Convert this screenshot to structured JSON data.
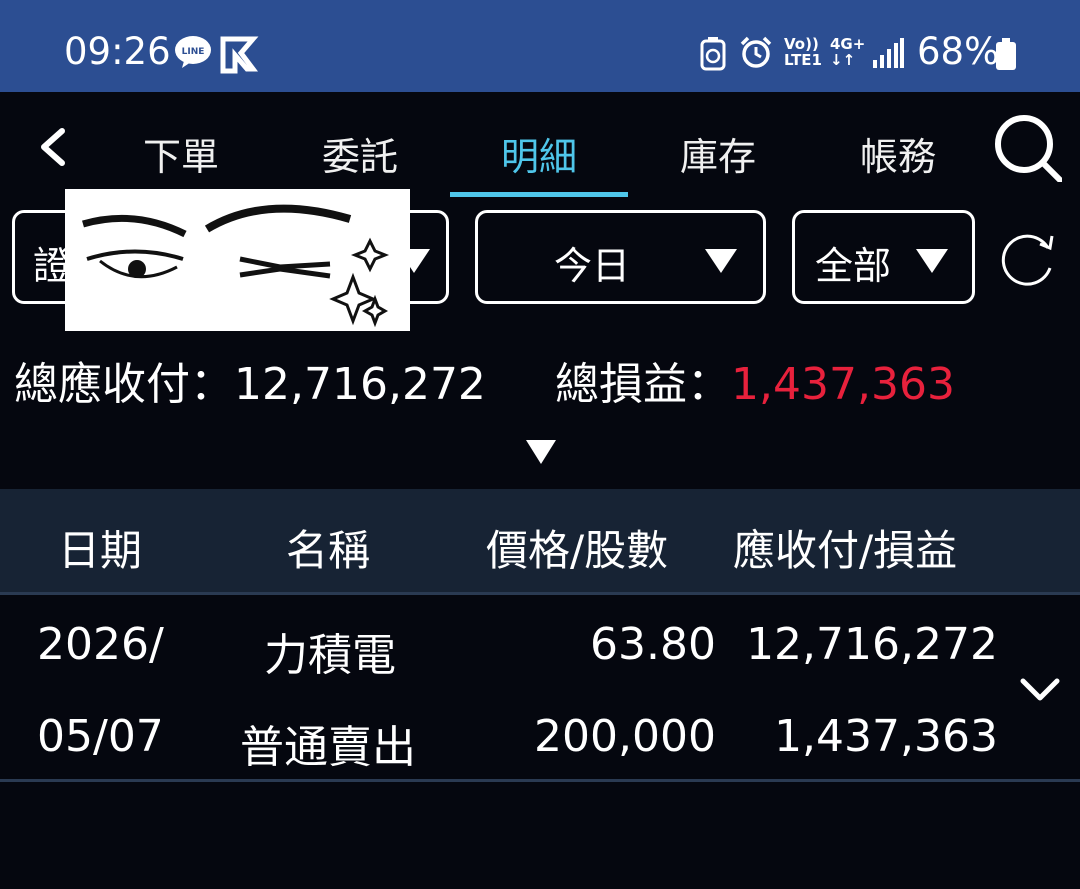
{
  "status_bar": {
    "time": "09:26",
    "line_icon_text": "LINE",
    "volte": "Vo))",
    "lte": "LTE1",
    "network": "4G+",
    "battery_pct": "68%",
    "icons": [
      "line-icon",
      "flag-icon",
      "recycle-icon",
      "alarm-icon",
      "signal-icon",
      "battery-icon"
    ]
  },
  "nav": {
    "tabs": [
      {
        "label": "下單",
        "active": false
      },
      {
        "label": "委託",
        "active": false
      },
      {
        "label": "明細",
        "active": true
      },
      {
        "label": "庫存",
        "active": false
      },
      {
        "label": "帳務",
        "active": false
      }
    ],
    "active_color": "#4fc6ea"
  },
  "filters": {
    "account_prefix": "證",
    "date_range": "今日",
    "category": "全部"
  },
  "totals": {
    "receivable_label": "總應收付：",
    "receivable_value": "12,716,272",
    "pnl_label": "總損益：",
    "pnl_value": "1,437,363"
  },
  "table": {
    "headers": [
      "日期",
      "名稱",
      "價格/股數",
      "應收付/損益"
    ],
    "rows": [
      {
        "date_line1": "2026/",
        "date_line2": "05/07",
        "name": "力積電",
        "order_type": "普通賣出",
        "price": "63.80",
        "shares": "200,000",
        "receivable": "12,716,272",
        "pnl": "1,437,363"
      }
    ]
  },
  "colors": {
    "status_bar": "#2c4e92",
    "background": "#05070f",
    "header_bg": "#172334",
    "profit_red": "#e8213c",
    "sell_green": "#2fc766"
  }
}
